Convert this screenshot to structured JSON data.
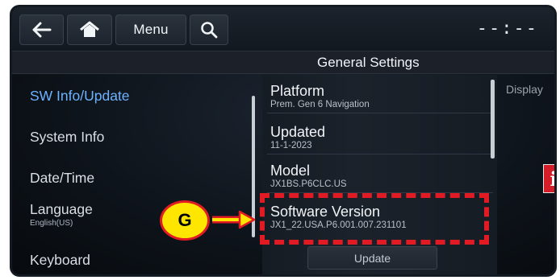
{
  "toolbar": {
    "menu_label": "Menu",
    "clock": "--:--"
  },
  "header": {
    "title": "General Settings"
  },
  "sidebar": {
    "items": [
      {
        "label": "SW Info/Update",
        "sub": ""
      },
      {
        "label": "System Info",
        "sub": ""
      },
      {
        "label": "Date/Time",
        "sub": ""
      },
      {
        "label": "Language",
        "sub": "English(US)"
      },
      {
        "label": "Keyboard",
        "sub": ""
      }
    ],
    "active_index": 0
  },
  "details": {
    "items": [
      {
        "title": "Platform",
        "value": "Prem. Gen 6 Navigation"
      },
      {
        "title": "Updated",
        "value": "11-1-2023"
      },
      {
        "title": "Model",
        "value": "JX1BS.P6CLC.US"
      },
      {
        "title": "Software Version",
        "value": "JX1_22.USA.P6.001.007.231101"
      }
    ],
    "update_button": "Update"
  },
  "right_panel": {
    "label": "Display",
    "badge": "i"
  },
  "annotation": {
    "callout_letter": "G"
  },
  "colors": {
    "active_item": "#6cb2ff",
    "annotation_red": "#e01b24",
    "callout_yellow": "#ffe600",
    "info_badge": "#d31e2a"
  },
  "icons": [
    "back-arrow-icon",
    "home-icon",
    "search-icon"
  ]
}
